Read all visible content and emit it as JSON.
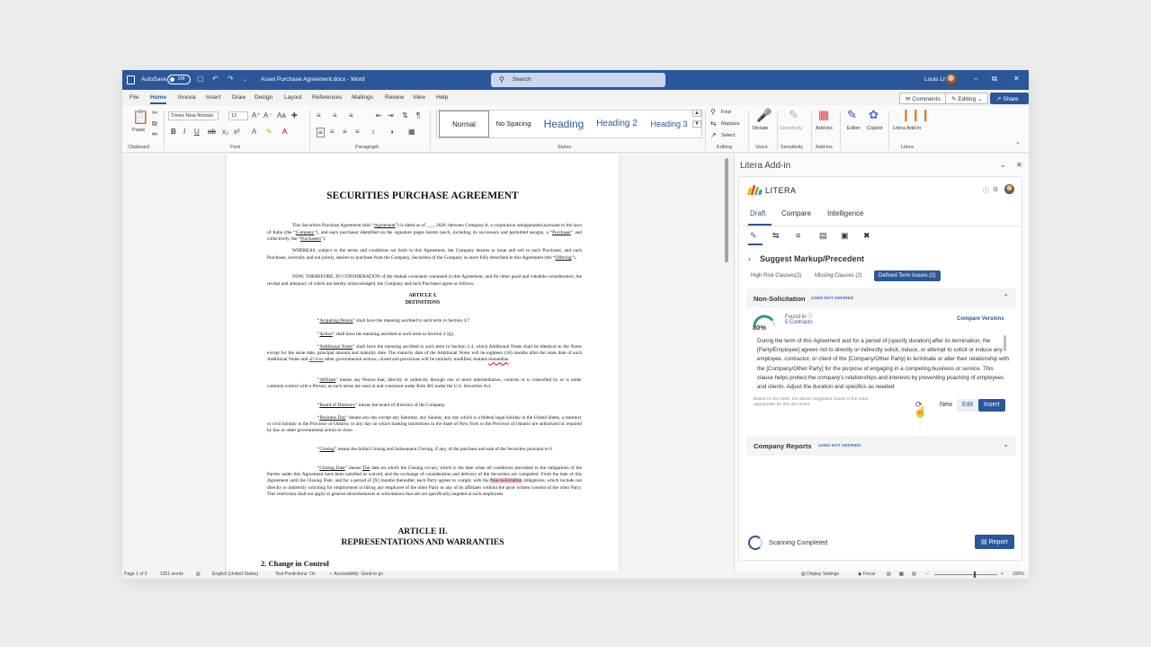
{
  "titlebar": {
    "autosave_label": "AutoSave",
    "autosave_state": "Off",
    "document_title": "Asset Purchase Agreement.docx - Word",
    "search_placeholder": "Search",
    "user_name": "Louis Litt"
  },
  "menu": {
    "tabs": [
      "File",
      "Home",
      "Innova",
      "Insert",
      "Draw",
      "Design",
      "Layout",
      "References",
      "Mailings",
      "Review",
      "View",
      "Help"
    ],
    "active_tab": "Home",
    "comments_label": "Comments",
    "editing_label": "Editing",
    "share_label": "Share"
  },
  "ribbon": {
    "clipboard": {
      "paste_label": "Paste",
      "group_label": "Clipboard"
    },
    "font": {
      "family": "Times New Roman",
      "size": "12",
      "group_label": "Font"
    },
    "paragraph": {
      "group_label": "Paragraph"
    },
    "styles": {
      "items": [
        "Normal",
        "No Spacing",
        "Heading",
        "Heading 2",
        "Heading 3"
      ],
      "group_label": "Styles"
    },
    "editing": {
      "find": "Find",
      "replace": "Replace",
      "select": "Select",
      "group_label": "Editing"
    },
    "voice": {
      "dictate": "Dictate",
      "group_label": "Voice"
    },
    "sensitivity": {
      "label": "Sensitivity",
      "group_label": "Sensitivity"
    },
    "addins": {
      "label": "Add-ins",
      "group_label": "Add-ins"
    },
    "editor": {
      "label": "Editor"
    },
    "copilot": {
      "label": "Copilot"
    },
    "litera": {
      "label": "Litera Add-in",
      "group_label": "Litera"
    }
  },
  "document": {
    "title": "SECURITIES PURCHASE AGREEMENT",
    "intro": {
      "p1": "This Securities Purchase Agreement (this “",
      "agreement": "Agreement",
      "p2": "”) is dated as of ___, 2020, between Company A, a corporation amalgamated pursuant to the laws of India (the “",
      "company": "Company",
      "p3": "”), and each purchaser identified on the signature pages hereto (each, including its successors and permitted assigns, a “",
      "purchaser": "Purchaser",
      "p4": "” and collectively, the “",
      "purchasers": "Purchasers",
      "p5": "”)."
    },
    "whereas": {
      "p1": "WHEREAS, subject to the terms and conditions set forth in this Agreement, the Company desires to issue and sell to each Purchaser, and each Purchaser, severally and not jointly, desires to purchase from the Company, Securities of the Company as more fully described in this Agreement (the “",
      "offering": "Offering",
      "p2": "”)."
    },
    "now_therefore": "NOW, THEREFORE, IN CONSIDERATION of the mutual covenants contained in this Agreement, and for other good and valuable consideration, the receipt and adequacy of which are hereby acknowledged, the Company and each Purchaser agree as follows:",
    "article1_title": "ARTICLE I.",
    "article1_sub": "DEFINITIONS",
    "defs": {
      "acquiring_term": "Acquiring Person",
      "acquiring_text": "” shall have the meaning ascribed to such term in Section 4.7.",
      "action_term": "Action",
      "action_text": "” shall have the meaning ascribed to such term in Section 3.1(j).",
      "additional_term": "Additional Notes",
      "additional_text1": "” shall have the meaning ascribed to such term in Section 2.4, which Additional Notes shall be identical to the Notes except for the issue date, principal amount and maturity date. The maturity date of the Additional Notes will be eighteen (18) months after the issue date of such Additional Notes and ",
      "additional_link": "all time",
      "additional_text2": " other governmental actions, closed and provisions will be similarly modified, mutatis ",
      "additional_err": "mutandias",
      "additional_text3": ".",
      "affiliate_term": "Affiliate",
      "affiliate_text": "” means any Person that, directly or indirectly through one or more intermediaries, controls or is controlled by or is under common control with a Person, as such terms are used in and construed under Rule 405 under the U.S. Securities Act.",
      "board_term": "Board of Directors",
      "board_text": "” means the board of directors of the Company.",
      "business_term": "Business Day",
      "business_text": "” means any day except any Saturday, any Sunday, any day which is a federal legal holiday in the United States, a statutory or civil holiday in the Province of Ontario, or any day on which banking institutions in the State of New York or the Province of Ontario are authorized or required by law or other governmental action to close.",
      "closing_term": "Closing",
      "closing_text": "” means the Initial Closing and Subsequent Closing, if any, of the purchase and sale of the Securities pursuant to 0",
      "closing_date_term": "Closing Date",
      "closing_date_text1": "” means ",
      "closing_date_the": "The",
      "closing_date_text2": " date on which the Closing occurs, which is the date when all conditions precedent to the obligations of the Parties under this Agreement have been satisfied or waived, and the exchange of consideration and delivery of the Securities are completed. From the date of this Agreement until the Closing Date, and for a period of [X] months thereafter, each Party agrees to comply with the ",
      "closing_date_hl": "Non-Solicitation",
      "closing_date_text3": " obligations, which include not directly or indirectly soliciting for employment or hiring any employee of the other Party or any of its affiliates without the prior written consent of the other Party. This restriction shall not apply to general advertisements or solicitations that are not specifically targeted at such employees."
    },
    "article2_title": "ARTICLE II.",
    "article2_sub": "REPRESENTATIONS AND WARRANTIES",
    "section2": "2. Change in Control"
  },
  "addin": {
    "pane_title": "Litera Add-in",
    "brand": "LITERA",
    "tabs": [
      "Draft",
      "Compare",
      "Intelligence"
    ],
    "active_tab": "Draft",
    "section_title": "Suggest Markup/Precedent",
    "filters": [
      "High Risk Clauses(2)",
      "Missing Clauses (2)",
      "Defined Term Issues (2)"
    ],
    "active_filter": "Defined Term Issues (2)",
    "issue1": {
      "title": "Non-Solicitation",
      "tag": "USED NOT DEFINED",
      "percent": "80%",
      "percent_value": 0.8,
      "found_in": "Found in",
      "contracts": "5 Contracts",
      "compare_versions": "Compare Versions",
      "clause_text": "During the term of this Agreement and for a period of [specify duration] after its termination, the [Party/Employee] agrees not to directly or indirectly solicit, induce, or attempt to solicit or induce any employee, contractor, or client of the [Company/Other Party] to terminate or alter their relationship with the [Company/Other Party] for the purpose of engaging in a competing business or service. This clause helps protect the company's relationships and interests by preventing poaching of employees and clients. Adjust the duration and specifics as needed",
      "note": "Based on the DMS, the above suggested clause is the most appropriate for this document.",
      "btn_new": "New",
      "btn_edit": "Edit",
      "btn_insert": "Insert"
    },
    "issue2": {
      "title": "Company Reports",
      "tag": "USED NOT DEFINED"
    },
    "scan_status": "Scanning Completed",
    "report_label": "Report"
  },
  "statusbar": {
    "page": "Page 1 of 2",
    "words": "1351 words",
    "language": "English (United States)",
    "predictions": "Text Predictions: On",
    "accessibility": "Accessibility: Good to go",
    "display_settings": "Display Settings",
    "focus": "Focus",
    "zoom": "100%"
  },
  "colors": {
    "word_blue": "#2b579a",
    "highlight": "#f6c9d0"
  }
}
